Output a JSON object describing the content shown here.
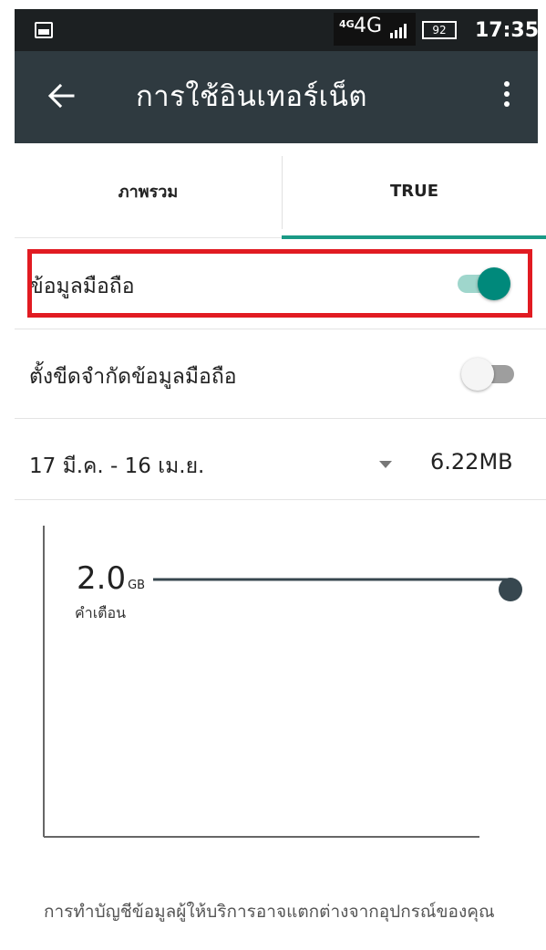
{
  "status_bar": {
    "network_small": "4G",
    "network_big": "4G",
    "battery": "92",
    "time": "17:35"
  },
  "app_bar": {
    "title": "การใช้อินเทอร์เน็ต"
  },
  "tabs": [
    {
      "label": "ภาพรวม",
      "selected": false
    },
    {
      "label": "TRUE",
      "selected": true
    }
  ],
  "mobile_data": {
    "label": "ข้อมูลมือถือ",
    "enabled": true
  },
  "data_limit": {
    "label": "ตั้งขีดจำกัดข้อมูลมือถือ",
    "enabled": false
  },
  "cycle": {
    "range": "17 มี.ค. - 16 เม.ย.",
    "usage": "6.22MB"
  },
  "chart": {
    "warning_value": "2.0",
    "warning_unit": "GB",
    "warning_label": "คำเตือน"
  },
  "footer_note": "การทำบัญชีข้อมูลผู้ให้บริการอาจแตกต่างจากอุปกรณ์ของคุณ",
  "colors": {
    "app_bar": "#2f3a40",
    "accent": "#00897b",
    "highlight": "#e11b22"
  }
}
